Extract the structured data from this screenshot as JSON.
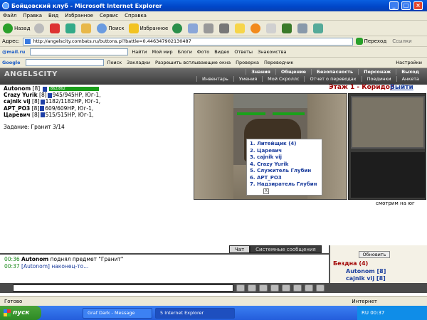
{
  "window": {
    "title": "Бойцовский клуб - Microsoft Internet Explorer",
    "min": "_",
    "max": "□",
    "close": "×"
  },
  "menu": [
    "Файл",
    "Правка",
    "Вид",
    "Избранное",
    "Сервис",
    "Справка"
  ],
  "toolbar": {
    "back": "Назад",
    "search": "Поиск",
    "favorites": "Избранное"
  },
  "address": {
    "label": "Адрес:",
    "url": "http://angelscity.combats.ru/buttons.pl?battle=0.446347902130487",
    "go": "Переход",
    "links": "Ссылки"
  },
  "toolbar2": {
    "brand": "@mail.ru",
    "find": "Найти",
    "items": [
      "Мой мир",
      "Блоги",
      "Фото",
      "Видео",
      "Ответы",
      "Знакомства"
    ]
  },
  "toolbar3": {
    "brand": "Google",
    "search": "Поиск",
    "bookmarks": "Закладки",
    "popups": "Разрешить всплывающие окна",
    "check": "Проверка",
    "translate": "Переводчик",
    "settings": "Настройки"
  },
  "game": {
    "logo": "ANGELSCITY",
    "nav1": [
      "Знания",
      "Общение",
      "Безопасность",
      "Персонаж",
      "Выход"
    ],
    "nav2": [
      "Инвентарь",
      "Умения",
      "Мой Скроллс",
      "Отчет о переводах",
      "Поединки",
      "Анкета"
    ],
    "player": {
      "name": "Autonom",
      "level": "[8]",
      "hp_text": "862/862"
    },
    "party": [
      {
        "name": "Crazy Yurik",
        "level": "[8]",
        "info": "945/945HP, Юг-1,"
      },
      {
        "name": "cajnik vij",
        "level": "[8]",
        "info": "1182/1182HP, Юг-1,"
      },
      {
        "name": "APT_PO3",
        "level": "[8]",
        "info": "609/609HP, Юг-1,"
      },
      {
        "name": "Царевич",
        "level": "[8]",
        "info": "515/515HP, Юг-1,"
      }
    ],
    "task": "Задание: Гранит 3/14",
    "floor": "Этаж 1 - Коридор",
    "exit": "Выйти",
    "npc_list": [
      "1. Литейщик (4)",
      "2. Царевич",
      "3. cajnik vij",
      "4. Crazy Yurik",
      "5. Служитель Глубин",
      "6. APT_PO3",
      "7. Надзиратель Глубин"
    ],
    "close_x": "X",
    "watch": "смотрим на юг",
    "tabs": [
      "Чат",
      "Системные сообщения"
    ],
    "chat": [
      {
        "time": "00:36",
        "author": "Autonom",
        "text": "поднял предмет \"Гранит\""
      },
      {
        "time": "00:37",
        "author": "[Autonom]",
        "text": "наконец-то..."
      }
    ],
    "side": {
      "update": "Обновить",
      "abyss": "Бездна (4)",
      "members": [
        "Autonom [8]",
        "cajnik vij [8]"
      ]
    }
  },
  "status": {
    "text": "Готово",
    "zone": "Интернет"
  },
  "taskbar": {
    "start": "пуск",
    "tasks": [
      "Graf Dark - Message",
      "5 Internet Explorer"
    ],
    "clock": "RU 00:37"
  }
}
